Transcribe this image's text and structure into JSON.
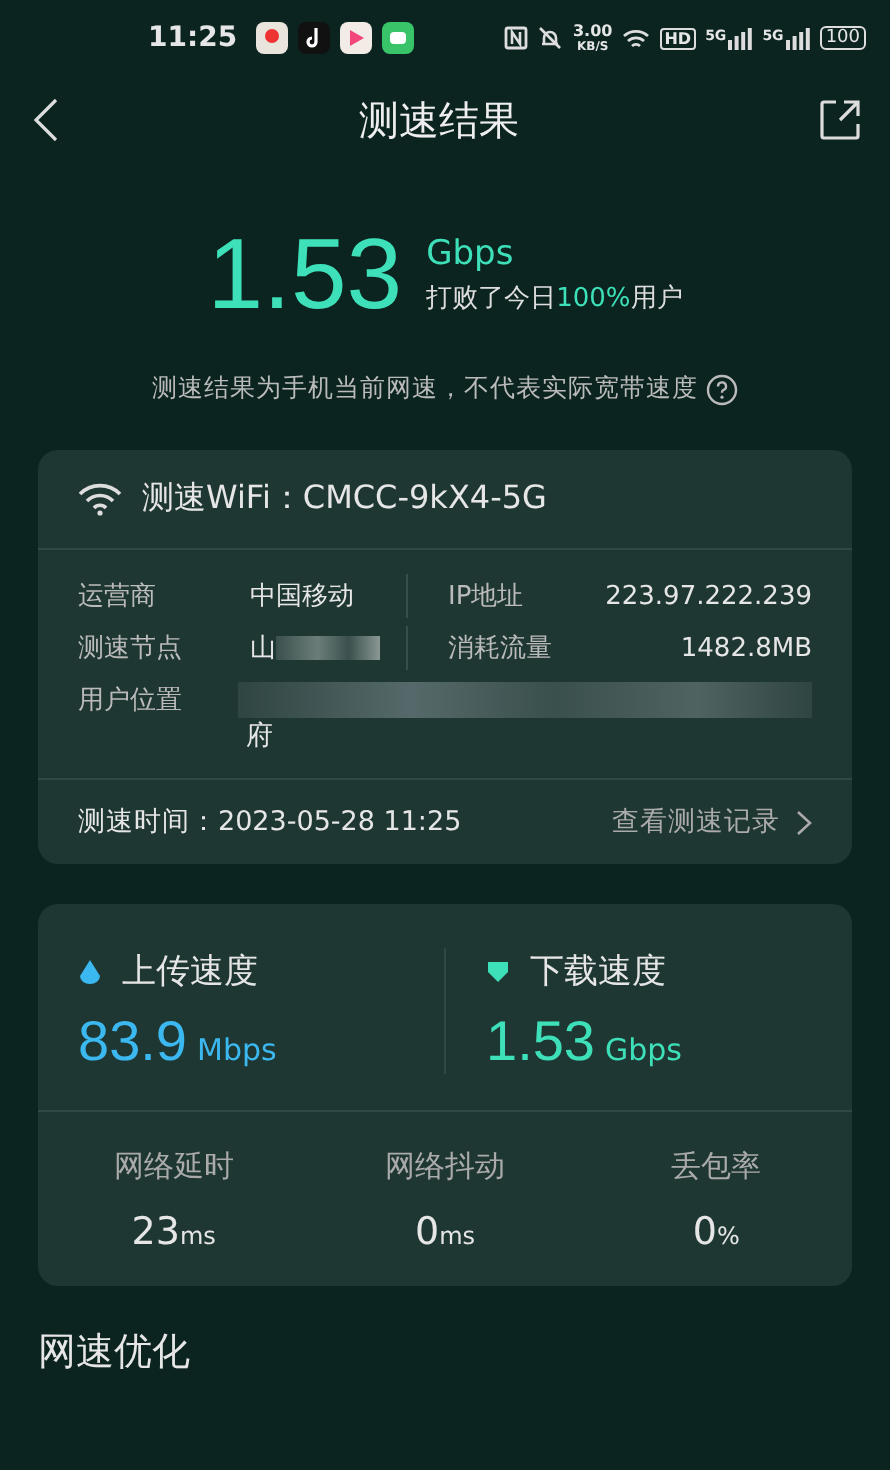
{
  "status_bar": {
    "time": "11:25",
    "net_speed": "3.00",
    "net_unit": "KB/S",
    "hd": "HD",
    "signals": [
      "5G",
      "5G"
    ],
    "battery": "100"
  },
  "header": {
    "title": "测速结果"
  },
  "result": {
    "value": "1.53",
    "unit": "Gbps",
    "beat_text": "打败了今日**100%**用户"
  },
  "note": "测速结果为手机当前网速，不代表实际宽带速度",
  "info_card": {
    "wifi_label": "测速WiFi：CMCC-9kX4-5G",
    "rows": [
      {
        "label": "运营商",
        "value": "中国移动",
        "label_2": "IP地址",
        "value_2": "223.97.222.239"
      },
      {
        "label": "测速节点",
        "value": "山",
        "redacted": true,
        "label_2": "消耗流量",
        "value_2": "1482.8MB"
      }
    ],
    "location": {
      "label": "用户位置",
      "value": "府",
      "redacted": true
    },
    "time": "测速时间：2023-05-28 11:25",
    "history_link": "查看测速记录"
  },
  "speed_card": {
    "speeds": [
      {
        "label": "上传速度",
        "value": "83.9",
        "unit": "Mbps",
        "kind": "upload",
        "color": "#3cb8f0"
      },
      {
        "label": "下载速度",
        "value": "1.53",
        "unit": "Gbps",
        "kind": "download",
        "color": "#3de0b8"
      }
    ],
    "metrics": [
      {
        "label": "网络延时",
        "value": "23",
        "unit": "ms"
      },
      {
        "label": "网络抖动",
        "value": "0",
        "unit": "ms"
      },
      {
        "label": "丢包率",
        "value": "0",
        "unit": "%"
      }
    ]
  },
  "section_title": "网速优化"
}
